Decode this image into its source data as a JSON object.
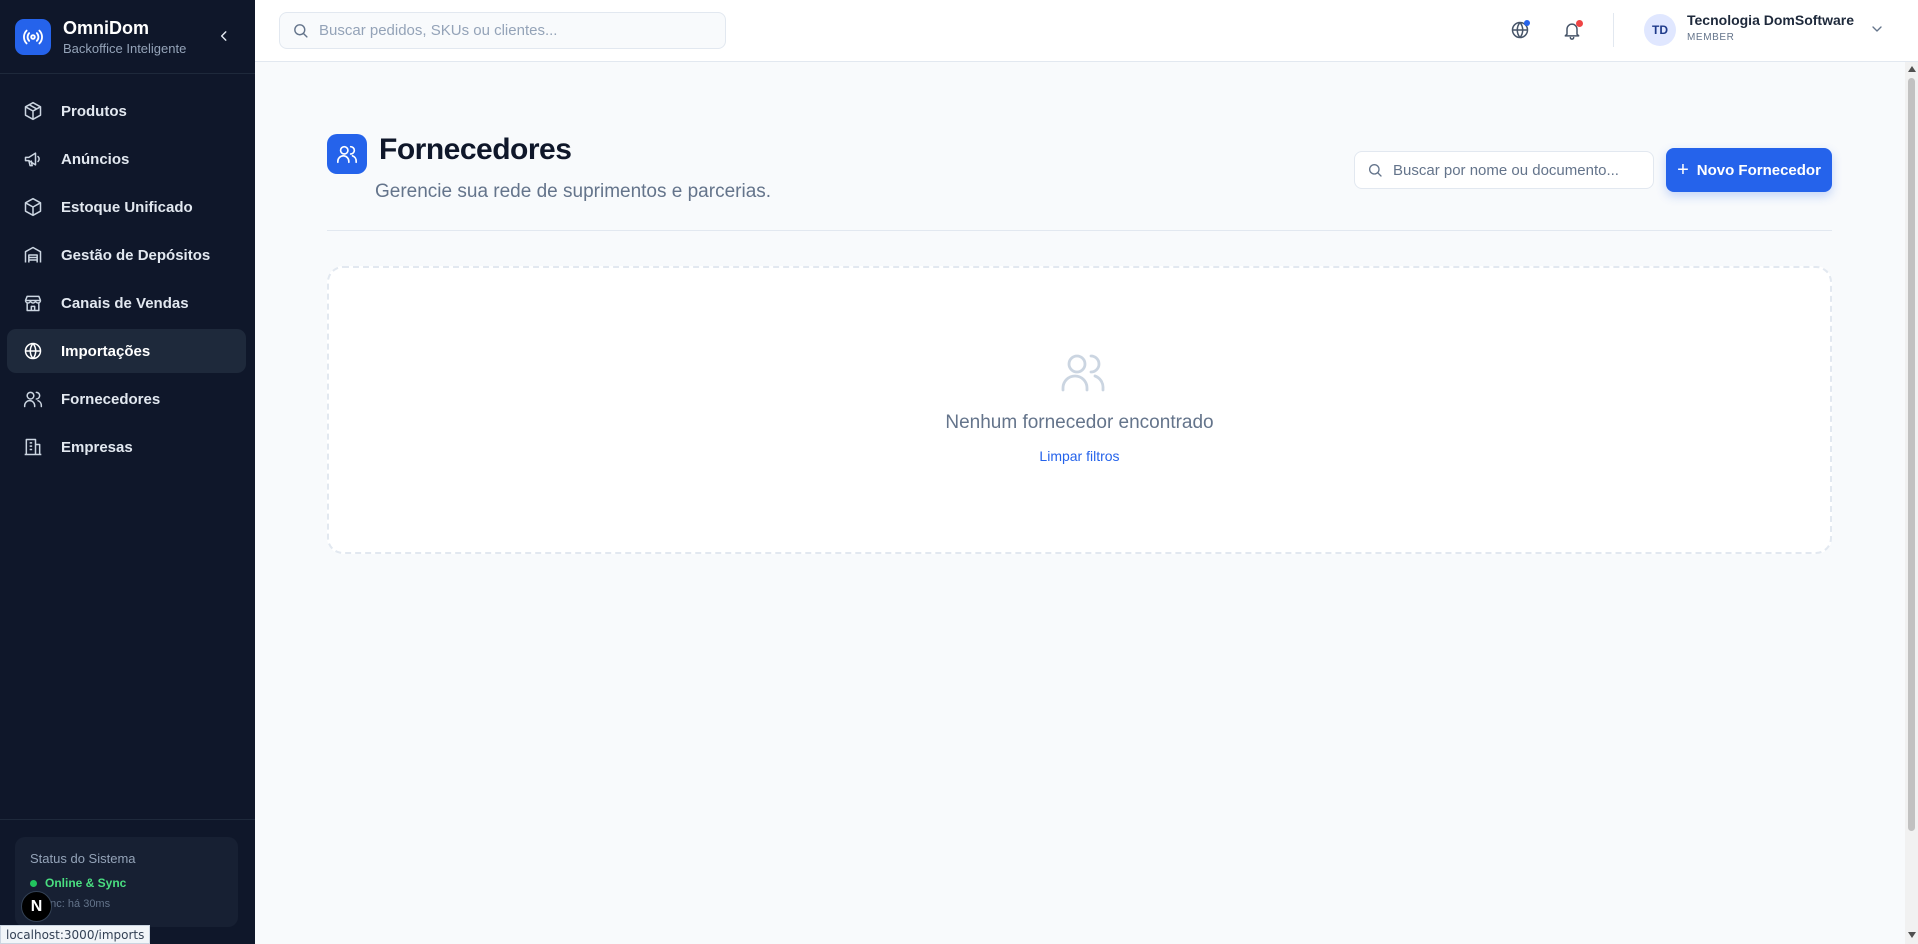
{
  "brand": {
    "name": "OmniDom",
    "subtitle": "Backoffice Inteligente"
  },
  "sidebar": {
    "items": [
      {
        "label": "Produtos",
        "icon": "package-icon",
        "active": false
      },
      {
        "label": "Anúncios",
        "icon": "megaphone-icon",
        "active": false
      },
      {
        "label": "Estoque Unificado",
        "icon": "box-icon",
        "active": false
      },
      {
        "label": "Gestão de Depósitos",
        "icon": "warehouse-icon",
        "active": false
      },
      {
        "label": "Canais de Vendas",
        "icon": "store-icon",
        "active": false
      },
      {
        "label": "Importações",
        "icon": "globe-icon",
        "active": true
      },
      {
        "label": "Fornecedores",
        "icon": "users-icon",
        "active": false
      },
      {
        "label": "Empresas",
        "icon": "building-icon",
        "active": false
      }
    ],
    "status": {
      "title": "Status do Sistema",
      "state": "Online & Sync",
      "sync": "a sync: há 30ms"
    }
  },
  "overlay": {
    "n_badge": "N",
    "url_tooltip": "localhost:3000/imports"
  },
  "topbar": {
    "search_placeholder": "Buscar pedidos, SKUs ou clientes...",
    "user": {
      "initials": "TD",
      "name": "Tecnologia DomSoftware",
      "role": "MEMBER"
    }
  },
  "page": {
    "title": "Fornecedores",
    "subtitle": "Gerencie sua rede de suprimentos e parcerias.",
    "filter_placeholder": "Buscar por nome ou documento...",
    "new_button": "Novo Fornecedor",
    "new_button_icon": "+",
    "empty": {
      "message": "Nenhum fornecedor encontrado",
      "clear_link": "Limpar filtros"
    }
  },
  "colors": {
    "sidebar_bg": "#0f172a",
    "accent": "#2563eb",
    "online": "#22c55e",
    "notification_dot": "#ef4444"
  }
}
